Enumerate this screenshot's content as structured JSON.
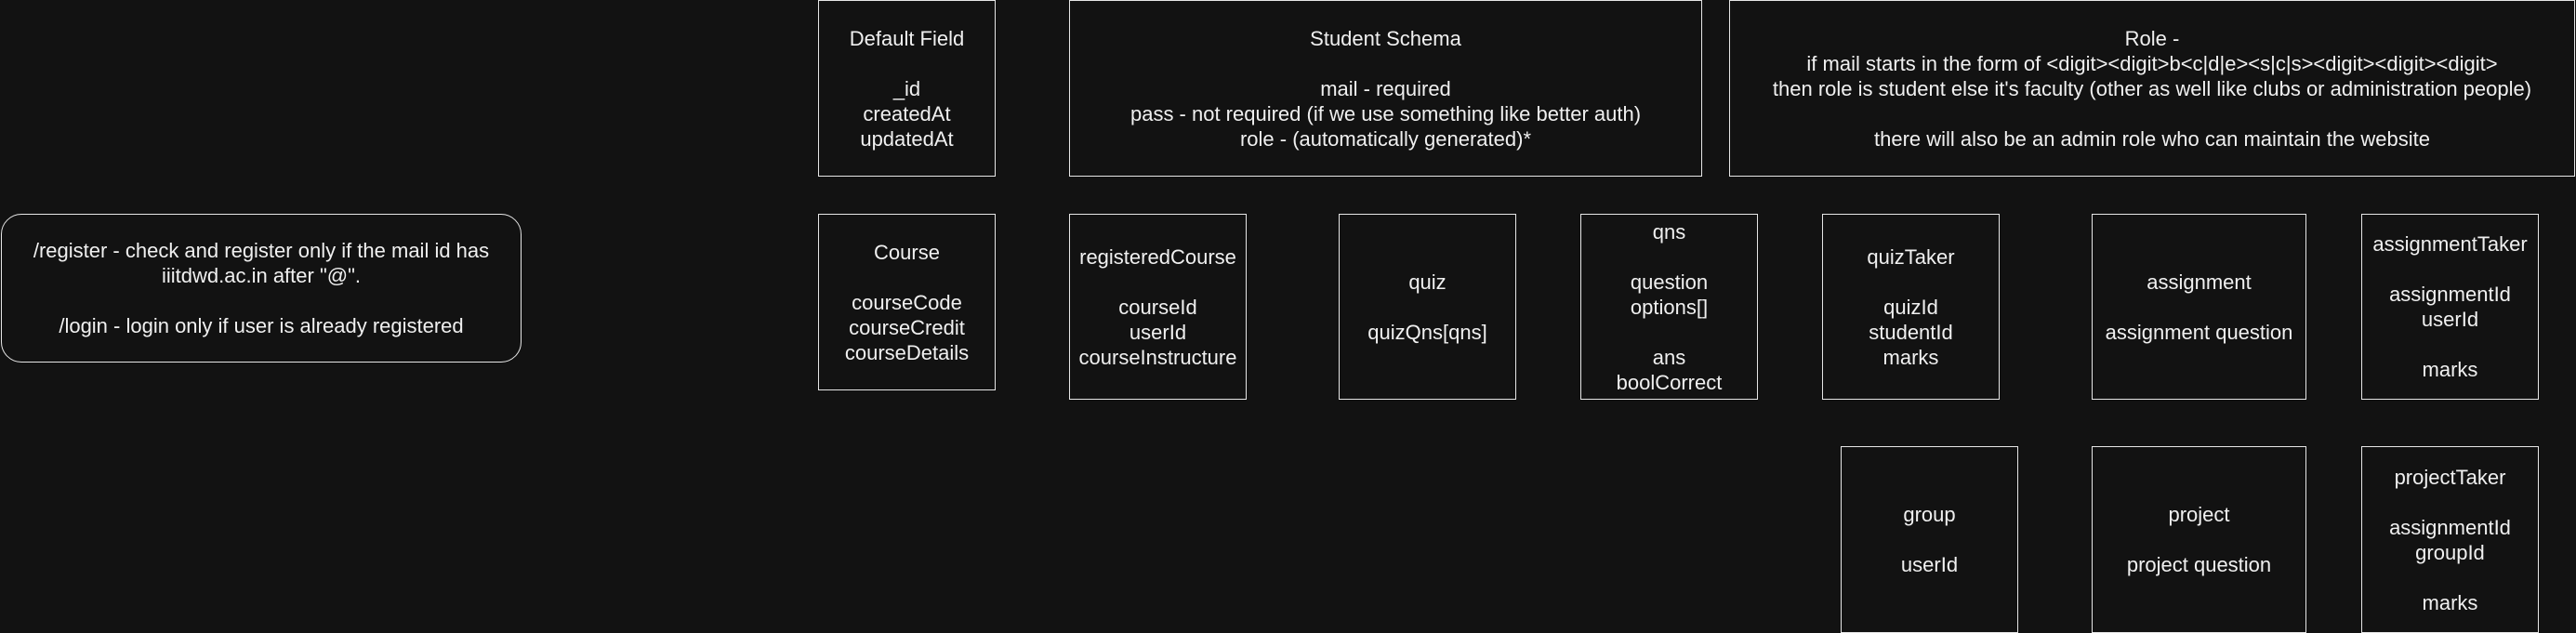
{
  "boxes": {
    "auth": "/register - check and register only if the mail id has iiitdwd.ac.in after \"@\".\n\n/login - login only if user is already registered",
    "default_field": "Default Field\n\n_id\ncreatedAt\nupdatedAt",
    "student_schema": "Student Schema\n\nmail - required\npass - not required (if we use something like better auth)\nrole - (automatically generated)*",
    "role": "Role -\nif mail starts in the form of <digit><digit>b<c|d|e><s|c|s><digit><digit><digit>\nthen role is student else it's faculty (other as well like clubs or administration people)\n\nthere will also be an admin role who can maintain the website",
    "course": "Course\n\ncourseCode\ncourseCredit\ncourseDetails",
    "registered_course": "registeredCourse\n\ncourseId\nuserId\ncourseInstructure",
    "quiz": "quiz\n\nquizQns[qns]",
    "qns": "qns\n\nquestion\noptions[]\n\nans\nboolCorrect",
    "quiz_taker": "quizTaker\n\nquizId\nstudentId\nmarks",
    "assignment": "assignment\n\nassignment question",
    "assignment_taker": "assignmentTaker\n\nassignmentId\nuserId\n\nmarks",
    "group": "group\n\nuserId",
    "project": "project\n\nproject question",
    "project_taker": "projectTaker\n\nassignmentId\ngroupId\n\nmarks"
  }
}
